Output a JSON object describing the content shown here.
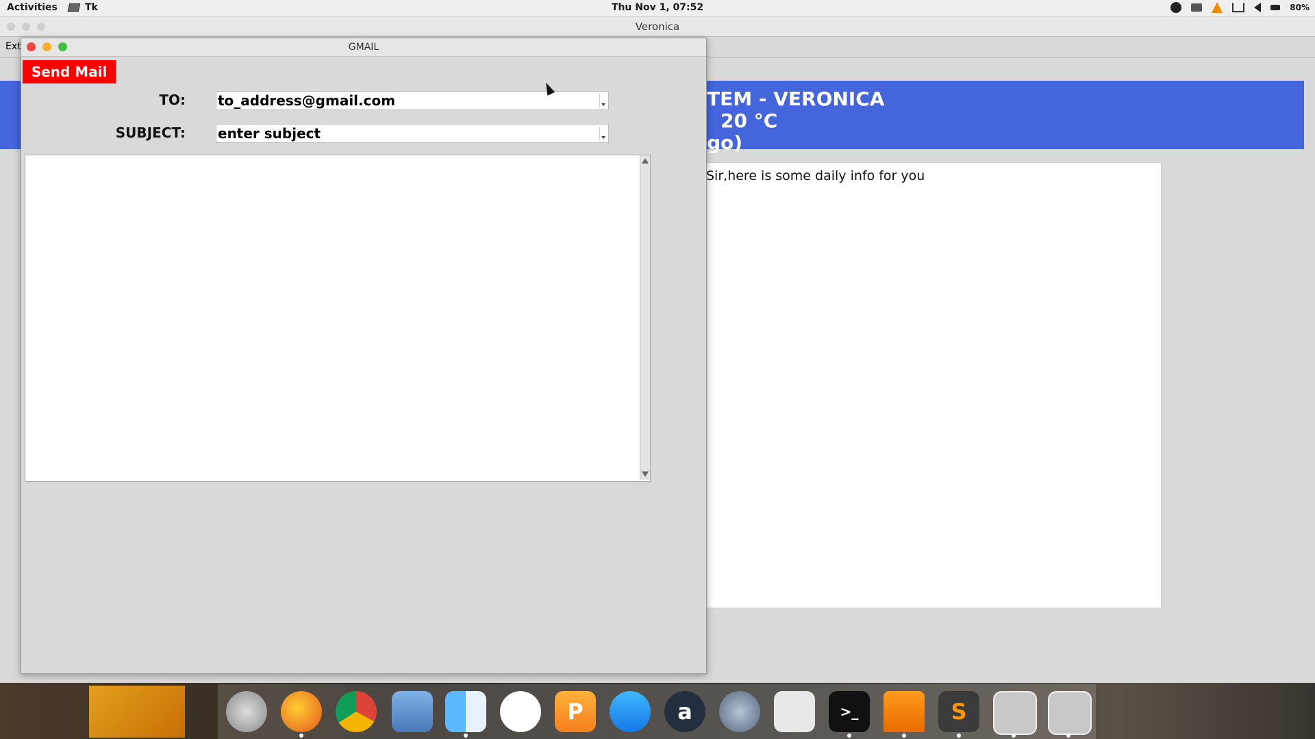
{
  "topbar": {
    "activities": "Activities",
    "app_name": "Tk",
    "clock": "Thu Nov  1, 07:52",
    "battery": "80%"
  },
  "bg_window": {
    "title": "Veronica",
    "menu_ext": "Ext",
    "banner_line1": "TEM - VERONICA",
    "banner_line2": "20 °C",
    "banner_line3": "go)",
    "info_text": "Sir,here is some daily info for you",
    "banner_color": "#4465dc"
  },
  "gmail": {
    "title": "GMAIL",
    "send_label": "Send Mail",
    "send_color": "#ff0000",
    "to_label": "TO:",
    "to_value": "to_address@gmail.com",
    "subject_label": "SUBJECT:",
    "subject_value": "enter subject",
    "body_value": ""
  },
  "dock": {
    "icons": [
      "rocket-icon",
      "firefox-icon",
      "chrome-icon",
      "eagle-icon",
      "finder-icon",
      "music-icon",
      "pages-icon",
      "app-store-icon",
      "amazon-icon",
      "globe-icon",
      "camera-icon",
      "terminal-icon",
      "vlc-icon",
      "sublime-icon",
      "window-icon",
      "window-icon"
    ],
    "amazon_glyph": "a",
    "pages_glyph": "P",
    "sublime_glyph": "S",
    "terminal_glyph": ">_"
  }
}
